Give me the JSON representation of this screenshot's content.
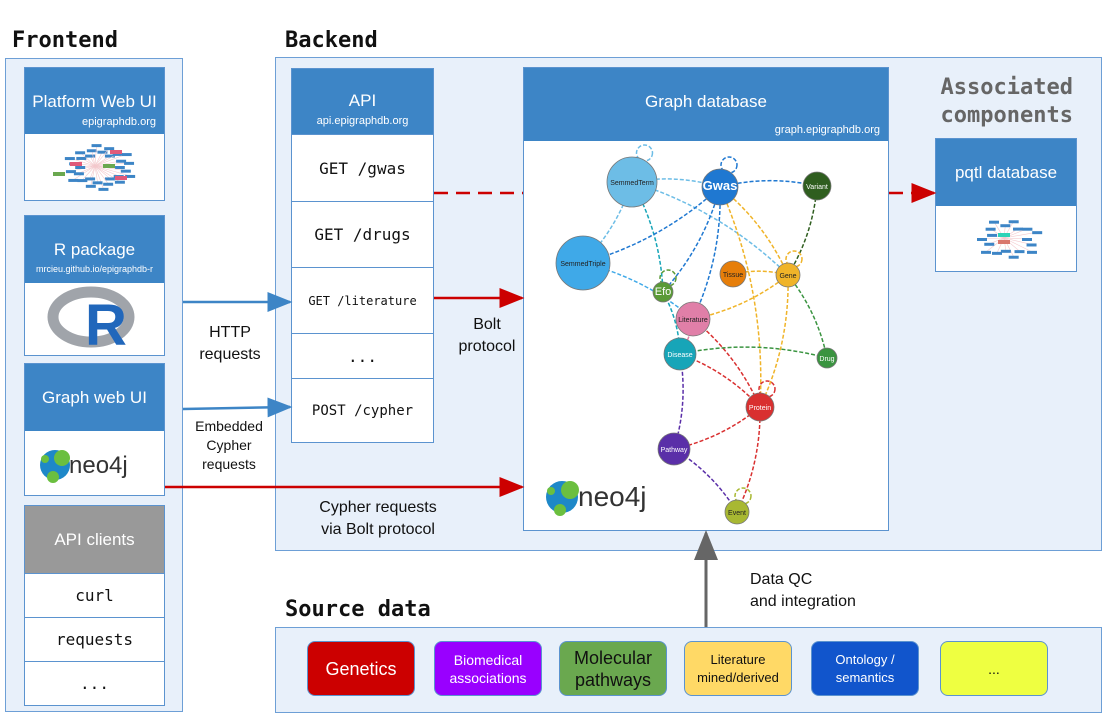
{
  "frontend": {
    "title": "Frontend",
    "platform": {
      "title": "Platform Web UI",
      "url": "epigraphdb.org"
    },
    "rpackage": {
      "title": "R package",
      "url": "mrcieu.github.io/epigraphdb-r"
    },
    "graphweb": {
      "title": "Graph web UI"
    },
    "clients": {
      "title": "API clients",
      "items": [
        "curl",
        "requests",
        "..."
      ]
    }
  },
  "backend": {
    "title": "Backend",
    "api": {
      "title": "API",
      "url": "api.epigraphdb.org",
      "endpoints": [
        "GET /gwas",
        "GET /drugs",
        "GET /literature",
        "...",
        "POST /cypher"
      ]
    },
    "graphdb": {
      "title": "Graph database",
      "url": "graph.epigraphdb.org",
      "nodes": [
        {
          "label": "SemmedTerm",
          "color": "#6dbde6"
        },
        {
          "label": "Gwas",
          "color": "#1f78d1"
        },
        {
          "label": "Variant",
          "color": "#2f5e1f"
        },
        {
          "label": "SemmedTriple",
          "color": "#3fa9e8"
        },
        {
          "label": "Tissue",
          "color": "#e67e0a"
        },
        {
          "label": "Gene",
          "color": "#f0b429"
        },
        {
          "label": "Efo",
          "color": "#5a9a36"
        },
        {
          "label": "Literature",
          "color": "#e07fa8"
        },
        {
          "label": "Disease",
          "color": "#17a5b8"
        },
        {
          "label": "Drug",
          "color": "#3a9440"
        },
        {
          "label": "Protein",
          "color": "#d93030"
        },
        {
          "label": "Pathway",
          "color": "#5a2fa8"
        },
        {
          "label": "Event",
          "color": "#a8b832"
        }
      ]
    },
    "associated": {
      "title_line1": "Associated",
      "title_line2": "components",
      "pqtl": {
        "title": "pqtl database"
      }
    }
  },
  "logos": {
    "neo4j": "neo4j",
    "r": "R"
  },
  "labels": {
    "http": [
      "HTTP",
      "requests"
    ],
    "embedded": [
      "Embedded",
      "Cypher",
      "requests"
    ],
    "bolt": [
      "Bolt",
      "protocol"
    ],
    "cypher_bolt": [
      "Cypher requests",
      "via Bolt protocol"
    ],
    "dataqc": [
      "Data QC",
      "and integration"
    ]
  },
  "source": {
    "title": "Source data",
    "items": [
      {
        "label": "Genetics",
        "bg": "#cc0000",
        "fg": "#ffffff"
      },
      {
        "label": "Biomedical associations",
        "bg": "#9900ff",
        "fg": "#ffffff"
      },
      {
        "label": "Molecular pathways",
        "bg": "#6aa84f",
        "fg": "#111111"
      },
      {
        "label": "Literature mined/derived",
        "bg": "#ffd966",
        "fg": "#111111"
      },
      {
        "label": "Ontology / semantics",
        "bg": "#1155cc",
        "fg": "#ffffff"
      },
      {
        "label": "...",
        "bg": "#eeff41",
        "fg": "#111111"
      }
    ]
  },
  "colors": {
    "header": "#3d85c6",
    "panel": "#e8f0fa",
    "http_arrow": "#3d85c6",
    "bolt_arrow": "#cc0000",
    "qc_arrow": "#666666"
  }
}
